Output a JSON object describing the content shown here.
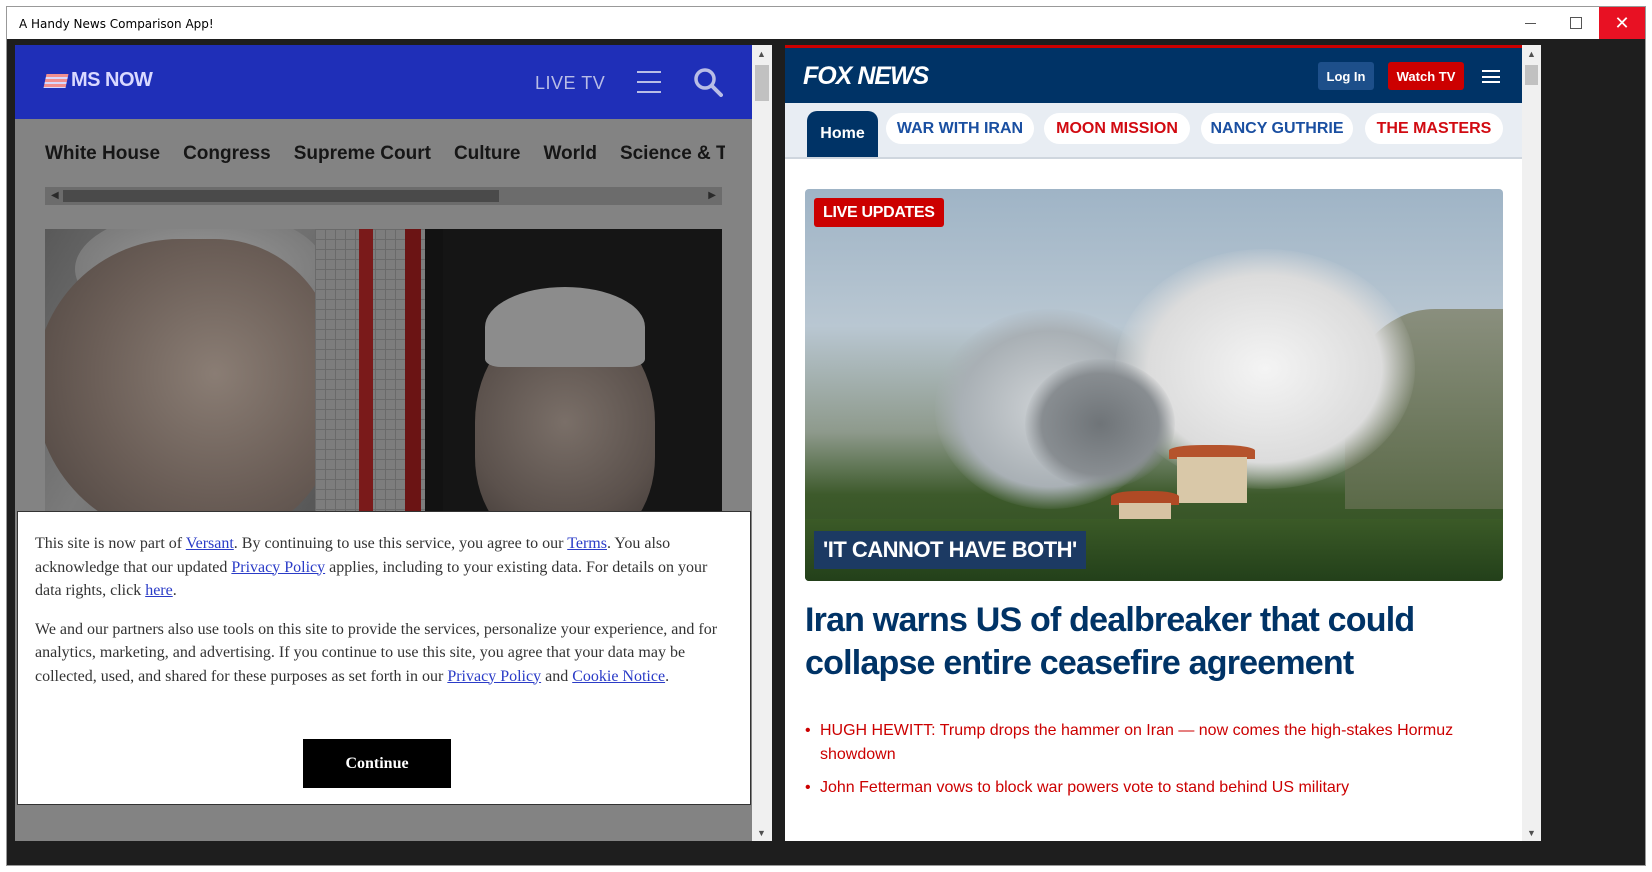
{
  "window": {
    "title": "A Handy News Comparison App!",
    "close_glyph": "✕"
  },
  "left": {
    "logo": "MS NOW",
    "live_tv": "LIVE TV",
    "nav_items": [
      "White House",
      "Congress",
      "Supreme Court",
      "Culture",
      "World",
      "Science & Tec"
    ],
    "consent": {
      "p1_a": "This site is now part of ",
      "p1_link1": "Versant",
      "p1_b": ". By continuing to use this service, you agree to our ",
      "p1_link2": "Terms",
      "p1_c": ". You also acknowledge that our updated ",
      "p1_link3": "Privacy Policy",
      "p1_d": " applies, including to your existing data. For details on your data rights, click ",
      "p1_link4": "here",
      "p1_e": ".",
      "p2_a": "We and our partners also use tools on this site to provide the services, personalize your experience, and for analytics, marketing, and advertising. If you continue to use this site, you agree that your data may be collected, used, and shared for these purposes as set forth in our ",
      "p2_link1": "Privacy Policy",
      "p2_b": " and ",
      "p2_link2": "Cookie Notice",
      "p2_c": ".",
      "continue_label": "Continue"
    }
  },
  "right": {
    "logo": "FOX NEWS",
    "login": "Log In",
    "watch_tv": "Watch TV",
    "tabs": [
      {
        "label": "Home"
      },
      {
        "label": "WAR WITH IRAN"
      },
      {
        "label": "MOON MISSION"
      },
      {
        "label": "NANCY GUTHRIE"
      },
      {
        "label": "THE MASTERS"
      }
    ],
    "hero": {
      "badge": "LIVE UPDATES",
      "quote": "'IT CANNOT HAVE BOTH'"
    },
    "headline": "Iran warns US of dealbreaker that could collapse entire ceasefire agreement",
    "bullets": [
      "HUGH HEWITT: Trump drops the hammer on Iran — now comes the high-stakes Hormuz showdown",
      "John Fetterman vows to block war powers vote to stand behind US military"
    ]
  },
  "colors": {
    "msn_blue": "#1f2fb8",
    "fox_navy": "#003366",
    "fox_red": "#cc0000",
    "link_blue": "#2a3bc7"
  }
}
